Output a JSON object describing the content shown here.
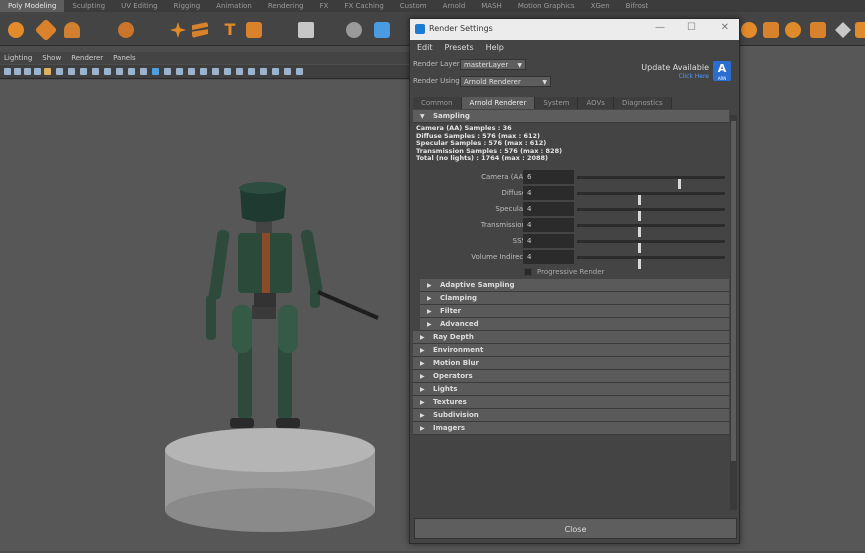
{
  "shelf_tabs": [
    "Poly Modeling",
    "Sculpting",
    "UV Editing",
    "Rigging",
    "Animation",
    "Rendering",
    "FX",
    "FX Caching",
    "Custom",
    "Arnold",
    "MASH",
    "Motion Graphics",
    "XGen",
    "Bifrost"
  ],
  "panel_menu": [
    "Lighting",
    "Show",
    "Renderer",
    "Panels"
  ],
  "window": {
    "title": "Render Settings",
    "menu": [
      "Edit",
      "Presets",
      "Help"
    ],
    "render_layer_label": "Render Layer",
    "render_layer_value": "masterLayer",
    "render_using_label": "Render Using",
    "render_using_value": "Arnold Renderer",
    "update_text": "Update Available",
    "update_link": "Click Here",
    "logo_letter": "A",
    "logo_text": "ARN",
    "tabs": [
      "Common",
      "Arnold Renderer",
      "System",
      "AOVs",
      "Diagnostics"
    ],
    "active_tab": "Arnold Renderer",
    "sampling": {
      "title": "Sampling",
      "stats": [
        "Camera (AA) Samples : 36",
        "Diffuse Samples : 576 (max : 612)",
        "Specular Samples : 576 (max : 612)",
        "Transmission Samples : 576 (max : 828)",
        "Total (no lights) : 1764 (max : 2088)"
      ],
      "params": [
        {
          "label": "Camera (AA)",
          "value": "6",
          "slider_fraction": 0.68
        },
        {
          "label": "Diffuse",
          "value": "4",
          "slider_fraction": 0.41
        },
        {
          "label": "Specular",
          "value": "4",
          "slider_fraction": 0.41
        },
        {
          "label": "Transmission",
          "value": "4",
          "slider_fraction": 0.41
        },
        {
          "label": "SSS",
          "value": "4",
          "slider_fraction": 0.41
        },
        {
          "label": "Volume Indirect",
          "value": "4",
          "slider_fraction": 0.41
        }
      ],
      "progressive_label": "Progressive Render",
      "subsections": [
        "Adaptive Sampling",
        "Clamping",
        "Filter",
        "Advanced"
      ]
    },
    "sections": [
      "Ray Depth",
      "Environment",
      "Motion Blur",
      "Operators",
      "Lights",
      "Textures",
      "Subdivision",
      "Imagers"
    ],
    "close_label": "Close"
  },
  "colors": {
    "accent": "#2a6fd0",
    "window_bg": "#444444",
    "viewport_bg": "#575757"
  }
}
